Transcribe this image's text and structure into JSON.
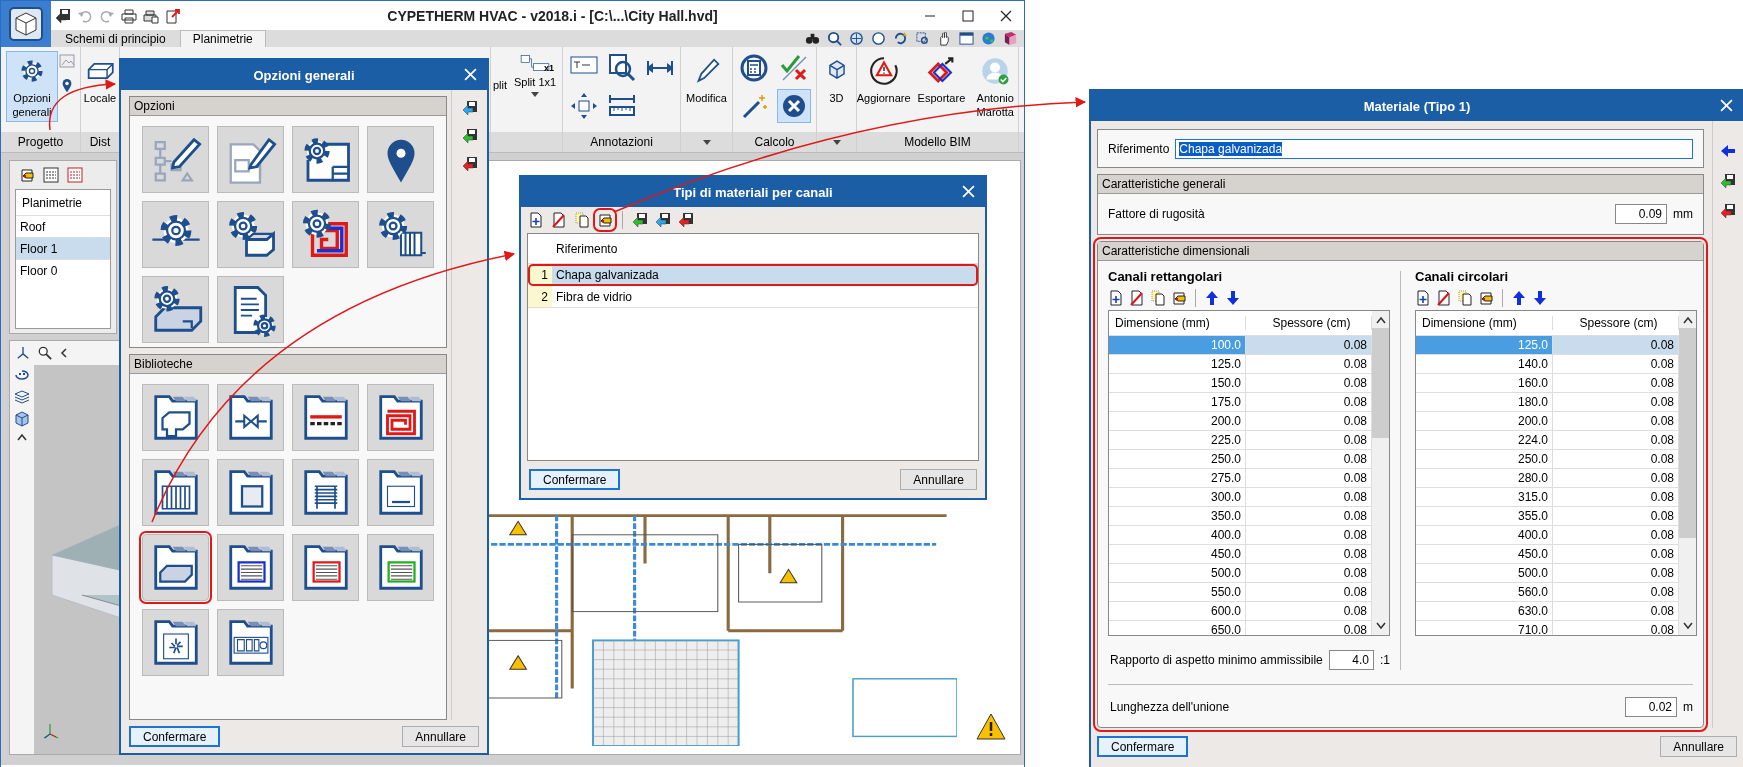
{
  "window": {
    "title": "CYPETHERM HVAC - v2018.i - [C:\\...\\City Hall.hvd]"
  },
  "tabs": [
    {
      "label": "Schemi di principio",
      "selected": false
    },
    {
      "label": "Planimetrie",
      "selected": true
    }
  ],
  "ribbon": {
    "groups": [
      {
        "label": "Progetto",
        "buttons": [
          {
            "label": "Opzioni generali",
            "selected": true
          }
        ]
      },
      {
        "label": "Dist",
        "buttons": [
          {
            "label": "Locale",
            "selected": false
          }
        ]
      },
      {
        "buttons": [
          {
            "label": "plit",
            "selected": false
          },
          {
            "label": "Split 1x1",
            "badge": "x1",
            "dropdown": true,
            "selected": false
          }
        ]
      },
      {
        "label": "Annotazioni",
        "tools": [
          {
            "selected": false
          },
          {
            "selected": false
          },
          {
            "selected": false
          },
          {
            "selected": false
          },
          {
            "selected": false
          }
        ]
      },
      {
        "buttons": [
          {
            "label": "Modifica",
            "selected": false
          }
        ],
        "dropdown": true
      },
      {
        "label": "Calcolo",
        "tools": [
          {
            "selected": false
          },
          {
            "selected": false
          },
          {
            "selected": false
          },
          {
            "selected": true
          }
        ]
      },
      {
        "buttons": [
          {
            "label": "3D",
            "selected": false
          }
        ],
        "dropdown": true
      },
      {
        "label": "Modello BIM",
        "buttons": [
          {
            "label": "Aggiornare",
            "selected": false
          },
          {
            "label": "Esportare",
            "selected": false
          },
          {
            "label": "Antonio Marotta",
            "selected": false
          }
        ]
      }
    ]
  },
  "floors": {
    "header": "Planimetrie",
    "rows": [
      {
        "label": "Roof",
        "selected": false
      },
      {
        "label": "Floor 1",
        "selected": true
      },
      {
        "label": "Floor 0",
        "selected": false
      }
    ]
  },
  "options_dialog": {
    "title": "Opzioni generali",
    "sections": [
      {
        "title": "Opzioni",
        "tiles": [
          {
            "highlighted": false
          },
          {
            "highlighted": false
          },
          {
            "highlighted": false
          },
          {
            "highlighted": false
          },
          {
            "highlighted": false
          },
          {
            "highlighted": false
          },
          {
            "highlighted": false
          },
          {
            "highlighted": false
          },
          {
            "highlighted": false
          },
          {
            "highlighted": false
          }
        ]
      },
      {
        "title": "Biblioteche",
        "tiles": [
          {
            "highlighted": false
          },
          {
            "highlighted": false
          },
          {
            "highlighted": false
          },
          {
            "highlighted": false
          },
          {
            "highlighted": false
          },
          {
            "highlighted": false
          },
          {
            "highlighted": false
          },
          {
            "highlighted": false
          },
          {
            "highlighted": true
          },
          {
            "highlighted": false
          },
          {
            "highlighted": false
          },
          {
            "highlighted": false
          },
          {
            "highlighted": false
          },
          {
            "highlighted": false
          }
        ]
      }
    ],
    "buttons": [
      "Confermare",
      "Annullare"
    ]
  },
  "types_dialog": {
    "title": "Tipi di materiali per canali",
    "toolbar": [
      {
        "highlighted": false
      },
      {
        "highlighted": false
      },
      {
        "highlighted": false
      },
      {
        "highlighted": true
      },
      {
        "highlighted": false
      },
      {
        "highlighted": false
      },
      {
        "highlighted": false
      }
    ],
    "column": "Riferimento",
    "rows": [
      {
        "number": "1",
        "name": "Chapa galvanizada",
        "selected": true,
        "highlighted": true
      },
      {
        "number": "2",
        "name": "Fibra de vidrio",
        "selected": false,
        "highlighted": false
      }
    ],
    "buttons": [
      "Confermare",
      "Annullare"
    ]
  },
  "material_dialog": {
    "title": "Materiale (Tipo 1)",
    "reference": {
      "label": "Riferimento",
      "value": "Chapa galvanizada"
    },
    "general": {
      "title": "Caratteristiche generali",
      "label": "Fattore di rugosità",
      "value": "0.09",
      "unit": "mm"
    },
    "dimensional": {
      "title": "Caratteristiche dimensionali",
      "highlighted": true,
      "tables": [
        {
          "title": "Canali rettangolari",
          "columns": [
            "Dimensione (mm)",
            "Spessore (cm)"
          ],
          "rows": [
            {
              "cells": [
                "100.0",
                "0.08"
              ],
              "selected": true
            },
            {
              "cells": [
                "125.0",
                "0.08"
              ],
              "selected": false
            },
            {
              "cells": [
                "150.0",
                "0.08"
              ],
              "selected": false
            },
            {
              "cells": [
                "175.0",
                "0.08"
              ],
              "selected": false
            },
            {
              "cells": [
                "200.0",
                "0.08"
              ],
              "selected": false
            },
            {
              "cells": [
                "225.0",
                "0.08"
              ],
              "selected": false
            },
            {
              "cells": [
                "250.0",
                "0.08"
              ],
              "selected": false
            },
            {
              "cells": [
                "275.0",
                "0.08"
              ],
              "selected": false
            },
            {
              "cells": [
                "300.0",
                "0.08"
              ],
              "selected": false
            },
            {
              "cells": [
                "350.0",
                "0.08"
              ],
              "selected": false
            },
            {
              "cells": [
                "400.0",
                "0.08"
              ],
              "selected": false
            },
            {
              "cells": [
                "450.0",
                "0.08"
              ],
              "selected": false
            },
            {
              "cells": [
                "500.0",
                "0.08"
              ],
              "selected": false
            },
            {
              "cells": [
                "550.0",
                "0.08"
              ],
              "selected": false
            },
            {
              "cells": [
                "600.0",
                "0.08"
              ],
              "selected": false
            },
            {
              "cells": [
                "650.0",
                "0.08"
              ],
              "selected": false
            }
          ]
        },
        {
          "title": "Canali circolari",
          "columns": [
            "Dimensione (mm)",
            "Spessore (cm)"
          ],
          "rows": [
            {
              "cells": [
                "125.0",
                "0.08"
              ],
              "selected": true
            },
            {
              "cells": [
                "140.0",
                "0.08"
              ],
              "selected": false
            },
            {
              "cells": [
                "160.0",
                "0.08"
              ],
              "selected": false
            },
            {
              "cells": [
                "180.0",
                "0.08"
              ],
              "selected": false
            },
            {
              "cells": [
                "200.0",
                "0.08"
              ],
              "selected": false
            },
            {
              "cells": [
                "224.0",
                "0.08"
              ],
              "selected": false
            },
            {
              "cells": [
                "250.0",
                "0.08"
              ],
              "selected": false
            },
            {
              "cells": [
                "280.0",
                "0.08"
              ],
              "selected": false
            },
            {
              "cells": [
                "315.0",
                "0.08"
              ],
              "selected": false
            },
            {
              "cells": [
                "355.0",
                "0.08"
              ],
              "selected": false
            },
            {
              "cells": [
                "400.0",
                "0.08"
              ],
              "selected": false
            },
            {
              "cells": [
                "450.0",
                "0.08"
              ],
              "selected": false
            },
            {
              "cells": [
                "500.0",
                "0.08"
              ],
              "selected": false
            },
            {
              "cells": [
                "560.0",
                "0.08"
              ],
              "selected": false
            },
            {
              "cells": [
                "630.0",
                "0.08"
              ],
              "selected": false
            },
            {
              "cells": [
                "710.0",
                "0.08"
              ],
              "selected": false
            }
          ]
        }
      ],
      "aspect": {
        "label": "Rapporto di aspetto minimo ammissibile",
        "value": "4.0",
        "unit": ":1"
      },
      "joint": {
        "label": "Lunghezza dell'unione",
        "value": "0.02",
        "unit": "m"
      }
    },
    "buttons": [
      "Confermare",
      "Annullare"
    ]
  }
}
